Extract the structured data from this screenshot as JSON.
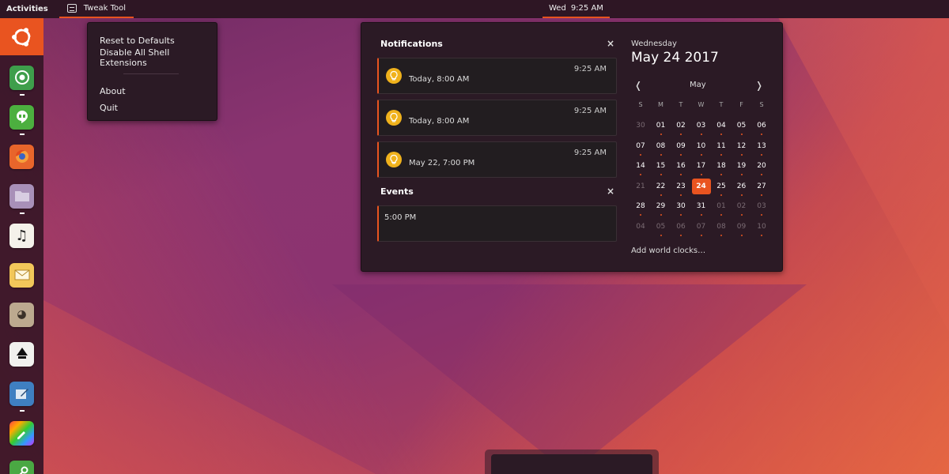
{
  "topbar": {
    "activities": "Activities",
    "app_name": "Tweak Tool",
    "clock_day": "Wed",
    "clock_time": "9:25 AM"
  },
  "app_menu": {
    "items": [
      "Reset to Defaults",
      "Disable All Shell Extensions",
      "About",
      "Quit"
    ]
  },
  "launcher": {
    "items": [
      {
        "name": "ubuntu-home",
        "running": false
      },
      {
        "name": "chrome",
        "running": true
      },
      {
        "name": "hangouts",
        "running": true
      },
      {
        "name": "firefox",
        "running": false
      },
      {
        "name": "files",
        "running": true
      },
      {
        "name": "music",
        "running": false
      },
      {
        "name": "mail",
        "running": false
      },
      {
        "name": "gimp",
        "running": false
      },
      {
        "name": "inkscape",
        "running": false
      },
      {
        "name": "drawing",
        "running": true
      },
      {
        "name": "color-picker",
        "running": false
      },
      {
        "name": "key-tool",
        "running": false
      }
    ]
  },
  "notifications": {
    "title": "Notifications",
    "close": "×",
    "items": [
      {
        "time": "9:25 AM",
        "body": "Today, 8:00 AM"
      },
      {
        "time": "9:25 AM",
        "body": "Today, 8:00 AM"
      },
      {
        "time": "9:25 AM",
        "body": "May 22, 7:00 PM"
      }
    ]
  },
  "events": {
    "title": "Events",
    "close": "×",
    "items": [
      {
        "text": "5:00 PM"
      }
    ]
  },
  "calendar": {
    "weekday": "Wednesday",
    "date": "May 24 2017",
    "month": "May",
    "prev": "❬",
    "next": "❭",
    "day_headers": [
      "S",
      "M",
      "T",
      "W",
      "T",
      "F",
      "S"
    ],
    "weeks": [
      [
        "30",
        "01",
        "02",
        "03",
        "04",
        "05",
        "06"
      ],
      [
        "07",
        "08",
        "09",
        "10",
        "11",
        "12",
        "13"
      ],
      [
        "14",
        "15",
        "16",
        "17",
        "18",
        "19",
        "20"
      ],
      [
        "21",
        "22",
        "23",
        "24",
        "25",
        "26",
        "27"
      ],
      [
        "28",
        "29",
        "30",
        "31",
        "01",
        "02",
        "03"
      ],
      [
        "04",
        "05",
        "06",
        "07",
        "08",
        "09",
        "10"
      ]
    ],
    "today": "24",
    "add_world_clocks": "Add world clocks…"
  },
  "colors": {
    "accent": "#e95420",
    "panel": "#2b1a25",
    "topbar": "#2e1624"
  }
}
